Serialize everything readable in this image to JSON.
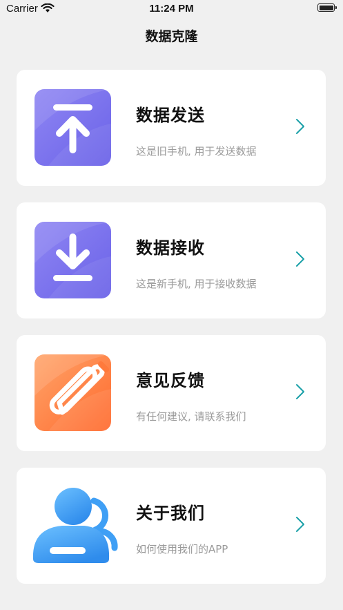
{
  "status_bar": {
    "carrier": "Carrier",
    "time": "11:24 PM",
    "icons": [
      "wifi-icon",
      "battery-icon"
    ]
  },
  "nav": {
    "title": "数据克隆"
  },
  "cards": [
    {
      "title": "数据发送",
      "subtitle": "这是旧手机, 用于发送数据",
      "icon": "upload-icon",
      "color": "#7b72ee"
    },
    {
      "title": "数据接收",
      "subtitle": "这是新手机, 用于接收数据",
      "icon": "download-icon",
      "color": "#7b72ee"
    },
    {
      "title": "意见反馈",
      "subtitle": "有任何建议, 请联系我们",
      "icon": "edit-pencil-icon",
      "color": "#ff7a3c"
    },
    {
      "title": "关于我们",
      "subtitle": "如何使用我们的APP",
      "icon": "users-icon",
      "color": "#3f9ff5"
    }
  ],
  "colors": {
    "accent": "#1aa0a8",
    "background": "#f0f0f0"
  }
}
